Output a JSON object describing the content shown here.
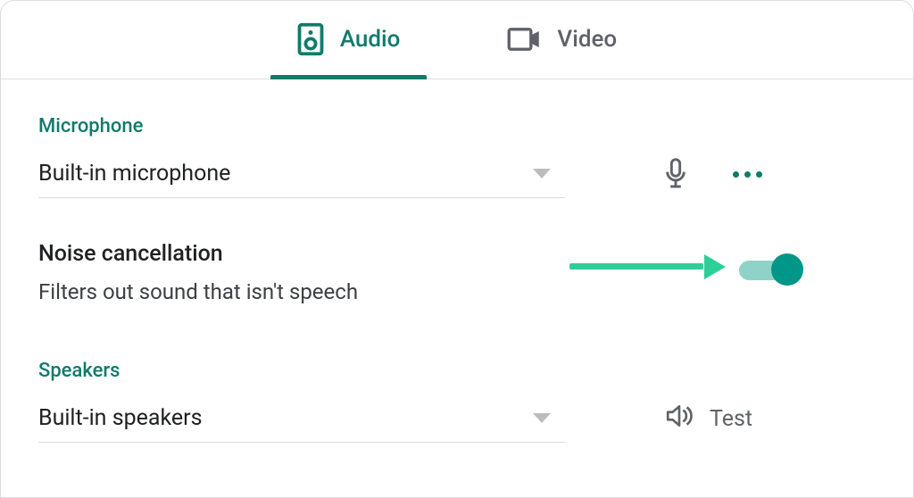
{
  "tabs": {
    "audio": "Audio",
    "video": "Video"
  },
  "microphone": {
    "label": "Microphone",
    "selected": "Built-in microphone"
  },
  "noise_cancellation": {
    "title": "Noise cancellation",
    "description": "Filters out sound that isn't speech"
  },
  "speakers": {
    "label": "Speakers",
    "selected": "Built-in speakers",
    "test_label": "Test"
  },
  "colors": {
    "accent": "#107b6a",
    "arrow": "#2fce98"
  }
}
